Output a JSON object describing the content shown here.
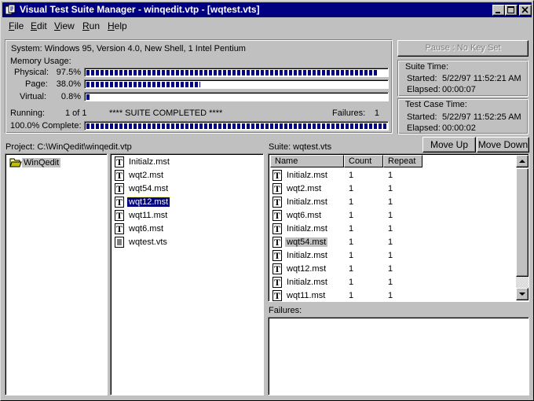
{
  "window": {
    "title": "Visual Test Suite Manager - winqedit.vtp - [wqtest.vts]"
  },
  "menu": [
    {
      "label": "File",
      "u": "F",
      "rest": "ile"
    },
    {
      "label": "Edit",
      "u": "E",
      "rest": "dit"
    },
    {
      "label": "View",
      "u": "V",
      "rest": "iew"
    },
    {
      "label": "Run",
      "u": "R",
      "rest": "un"
    },
    {
      "label": "Help",
      "u": "H",
      "rest": "elp"
    }
  ],
  "status": {
    "system": "System: Windows 95, Version 4.0, New Shell, 1 Intel Pentium",
    "memory_usage_label": "Memory Usage:",
    "physical_label": "Physical:",
    "physical_value": "97.5%",
    "physical_fraction": 0.975,
    "page_label": "Page:",
    "page_value": "38.0%",
    "page_fraction": 0.38,
    "virtual_label": "Virtual:",
    "virtual_value": "0.8%",
    "virtual_fraction": 0.008,
    "running_label": "Running:",
    "running_value": "1 of 1",
    "suite_status": "**** SUITE COMPLETED ****",
    "failures_label": "Failures:",
    "failures_value": "1",
    "complete_label": "100.0% Complete:",
    "complete_fraction": 1.0
  },
  "pause_button": "Pause : No Key Set",
  "suite_time": {
    "title": "Suite Time:",
    "started_label": "Started:",
    "started_value": "5/22/97 11:52:21 AM",
    "elapsed_label": "Elapsed:",
    "elapsed_value": "00:00:07"
  },
  "test_case_time": {
    "title": "Test Case Time:",
    "started_label": "Started:",
    "started_value": "5/22/97 11:52:25 AM",
    "elapsed_label": "Elapsed:",
    "elapsed_value": "00:00:02"
  },
  "project": {
    "label": "Project: C:\\WinQedit\\winqedit.vtp",
    "folder": "WinQedit",
    "files": [
      "Initialz.mst",
      "wqt2.mst",
      "wqt54.mst",
      "wqt12.mst",
      "wqt11.mst",
      "wqt6.mst",
      "wqtest.vts"
    ],
    "selected_file_index": 3
  },
  "suite": {
    "label": "Suite: wqtest.vts",
    "move_up": "Move Up",
    "move_down": "Move Down",
    "columns": [
      "Name",
      "Count",
      "Repeat"
    ],
    "rows": [
      {
        "name": "Initialz.mst",
        "count": "1",
        "repeat": "1"
      },
      {
        "name": "wqt2.mst",
        "count": "1",
        "repeat": "1"
      },
      {
        "name": "Initialz.mst",
        "count": "1",
        "repeat": "1"
      },
      {
        "name": "wqt6.mst",
        "count": "1",
        "repeat": "1"
      },
      {
        "name": "Initialz.mst",
        "count": "1",
        "repeat": "1"
      },
      {
        "name": "wqt54.mst",
        "count": "1",
        "repeat": "1"
      },
      {
        "name": "Initialz.mst",
        "count": "1",
        "repeat": "1"
      },
      {
        "name": "wqt12.mst",
        "count": "1",
        "repeat": "1"
      },
      {
        "name": "Initialz.mst",
        "count": "1",
        "repeat": "1"
      },
      {
        "name": "wqt11.mst",
        "count": "1",
        "repeat": "1"
      }
    ],
    "highlighted_row_index": 5
  },
  "failures": {
    "label": "Failures:"
  },
  "colors": {
    "titlebar": "#000080",
    "face": "#c0c0c0",
    "progress": "#000080"
  }
}
